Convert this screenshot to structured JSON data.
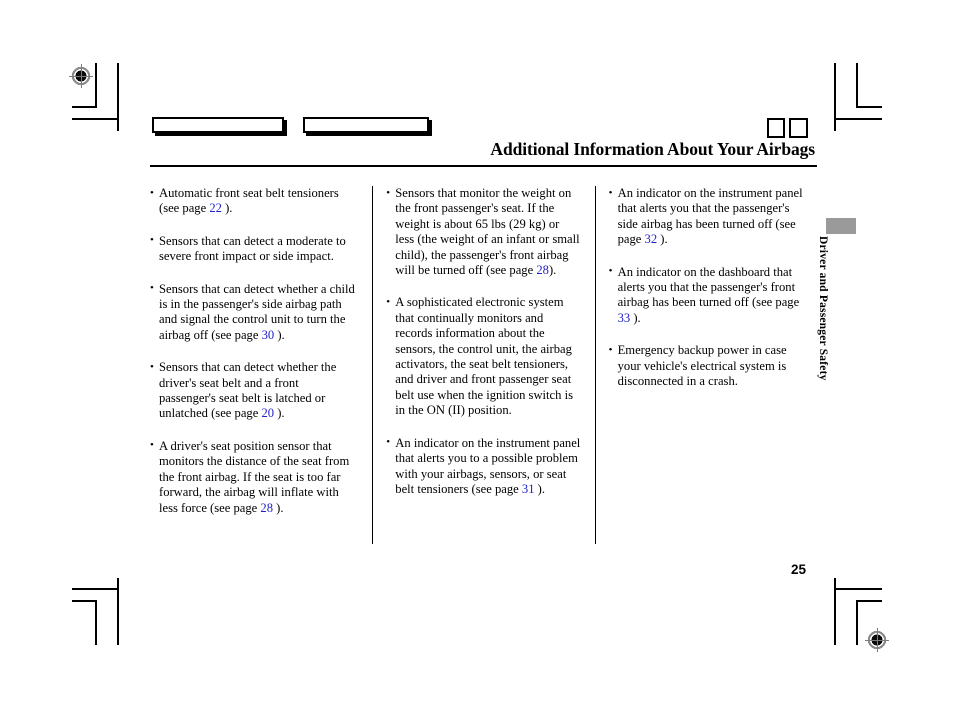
{
  "document": {
    "header_title": "Additional Information About Your Airbags",
    "side_tab_label": "Driver and Passenger Safety",
    "page_number": "25"
  },
  "columns": [
    {
      "id": "column-1",
      "bullets": [
        {
          "segments": [
            {
              "text": "Automatic front seat belt tensioners (see page "
            },
            {
              "text": "22",
              "link": true
            },
            {
              "text": " )."
            }
          ]
        },
        {
          "segments": [
            {
              "text": "Sensors that can detect a moderate to severe front impact or side impact."
            }
          ]
        },
        {
          "segments": [
            {
              "text": "Sensors that can detect whether a child is in the passenger's side airbag path and signal the control unit to turn the airbag off (see page "
            },
            {
              "text": "30",
              "link": true
            },
            {
              "text": " )."
            }
          ]
        },
        {
          "segments": [
            {
              "text": "Sensors that can detect whether the driver's seat belt and a front passenger's seat belt is latched or unlatched (see page "
            },
            {
              "text": "20",
              "link": true
            },
            {
              "text": " )."
            }
          ]
        },
        {
          "segments": [
            {
              "text": "A driver's seat position sensor that monitors the distance of the seat from the front airbag. If the seat is too far forward, the airbag will inflate with less force (see page "
            },
            {
              "text": "28",
              "link": true
            },
            {
              "text": " )."
            }
          ]
        }
      ]
    },
    {
      "id": "column-2",
      "bullets": [
        {
          "segments": [
            {
              "text": "Sensors that monitor the weight on the front passenger's seat. If the weight is about 65 lbs (29 kg) or less (the weight of an infant or small child), the passenger's front airbag will be turned off (see page "
            },
            {
              "text": "28",
              "link": true
            },
            {
              "text": ")."
            }
          ]
        },
        {
          "segments": [
            {
              "text": "A sophisticated electronic system that continually monitors and records information about the sensors, the control unit, the airbag activators, the seat belt tensioners, and driver and front passenger seat belt use when the ignition switch is in the ON (II) position."
            }
          ]
        },
        {
          "segments": [
            {
              "text": "An indicator on the instrument panel that alerts you to a possible problem with your airbags, sensors, or seat belt tensioners (see page "
            },
            {
              "text": "31",
              "link": true
            },
            {
              "text": " )."
            }
          ]
        }
      ]
    },
    {
      "id": "column-3",
      "bullets": [
        {
          "segments": [
            {
              "text": "An indicator on the instrument panel that alerts you that the passenger's side airbag has been turned off (see page "
            },
            {
              "text": "32",
              "link": true
            },
            {
              "text": " )."
            }
          ]
        },
        {
          "segments": [
            {
              "text": "An indicator on the dashboard that alerts you that the passenger's front airbag has been turned off (see page "
            },
            {
              "text": "33",
              "link": true
            },
            {
              "text": " )."
            }
          ]
        },
        {
          "segments": [
            {
              "text": "Emergency backup power in case your vehicle's electrical system is disconnected in a crash."
            }
          ]
        }
      ]
    }
  ],
  "header_marks": {
    "box_1_label": "",
    "box_2_label": "",
    "square_1_label": "",
    "square_2_label": ""
  },
  "colors": {
    "link": "#2222cc",
    "rule": "#000000",
    "side_tab": "#9a9a9a"
  }
}
